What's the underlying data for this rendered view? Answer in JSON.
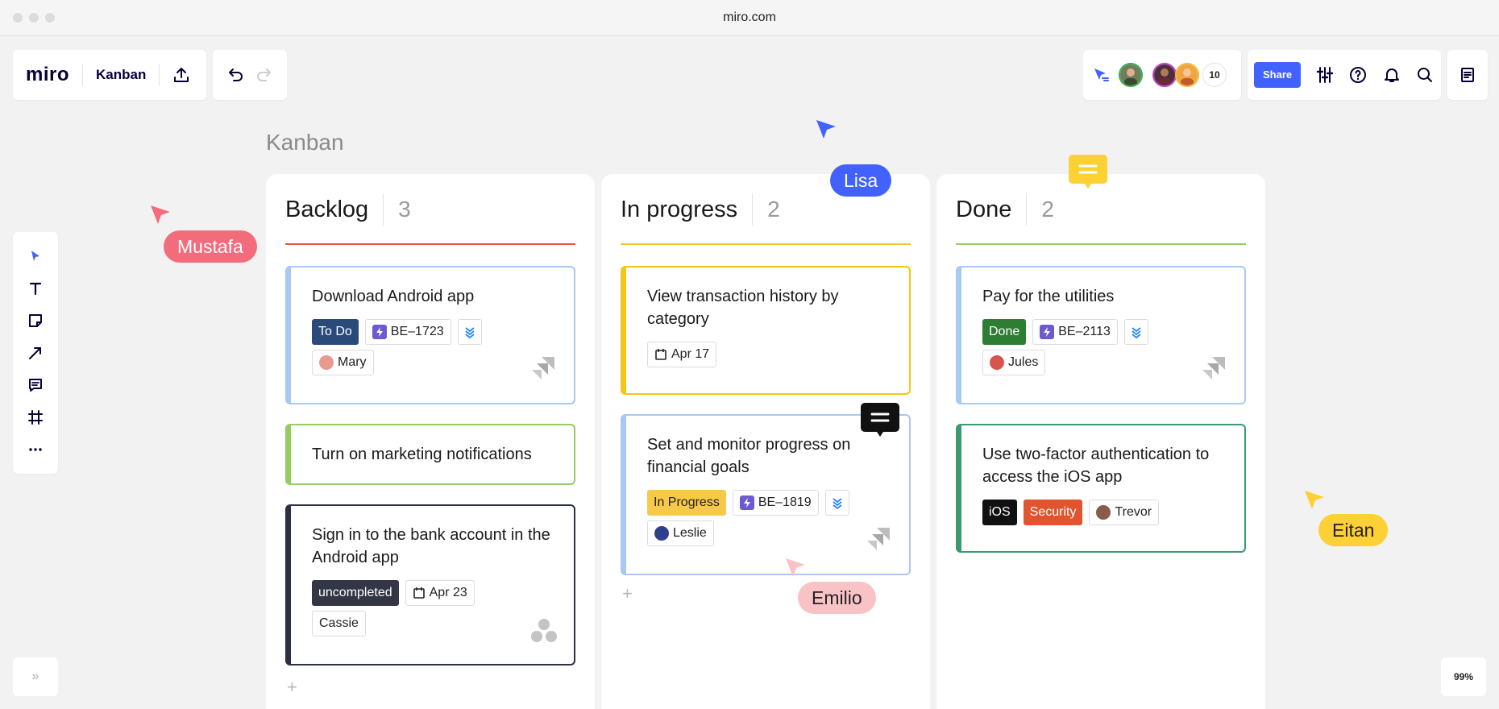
{
  "browser": {
    "url": "miro.com"
  },
  "topbar": {
    "logo": "miro",
    "board_name": "Kanban",
    "collaborator_count": "10",
    "share_label": "Share"
  },
  "board": {
    "title": "Kanban"
  },
  "columns": [
    {
      "title": "Backlog",
      "count": "3",
      "line_color": "#e5553b",
      "cards": [
        {
          "title": "Download Android app",
          "status": "To Do",
          "ticket": "BE–1723",
          "assignee": "Mary",
          "border_color": "#a8c8f5"
        },
        {
          "title": "Turn on marketing notifications",
          "border_color": "#95cc61"
        },
        {
          "title": "Sign in to the bank account in the Android app",
          "status": "uncompleted",
          "date": "Apr 23",
          "assignee": "Cassie",
          "border_color": "#2d2f45"
        }
      ]
    },
    {
      "title": "In progress",
      "count": "2",
      "line_color": "#f2c230",
      "cards": [
        {
          "title": "View transaction history by category",
          "date": "Apr 17",
          "border_color": "#f5c518"
        },
        {
          "title": "Set and monitor progress on financial goals",
          "status": "In Progress",
          "ticket": "BE–1819",
          "assignee": "Leslie",
          "border_color": "#a8c8f5"
        }
      ]
    },
    {
      "title": "Done",
      "count": "2",
      "line_color": "#95cc61",
      "cards": [
        {
          "title": "Pay for the utilities",
          "status": "Done",
          "ticket": "BE–2113",
          "assignee": "Jules",
          "border_color": "#a8c8f5"
        },
        {
          "title": "Use two-factor authentication to access the iOS app",
          "tag1": "iOS",
          "tag2": "Security",
          "assignee": "Trevor",
          "border_color": "#3a9a6e"
        }
      ]
    }
  ],
  "cursors": {
    "mustafa": "Mustafa",
    "lisa": "Lisa",
    "emilio": "Emilio",
    "eitan": "Eitan"
  },
  "colors": {
    "accent": "#4262ff",
    "mustafa": "#f26c7c",
    "lisa": "#4262ff",
    "emilio": "#f9c3c6",
    "eitan": "#fdd035",
    "todo_tag": "#2a4a7a",
    "done_tag": "#2f7d32",
    "inprogress_tag": "#f7c948",
    "uncompleted_tag": "#333645",
    "ios_tag": "#111111",
    "security_tag": "#e0552f"
  },
  "zoom": {
    "level": "99%"
  },
  "sidebar_toggle": {
    "label": "»"
  }
}
